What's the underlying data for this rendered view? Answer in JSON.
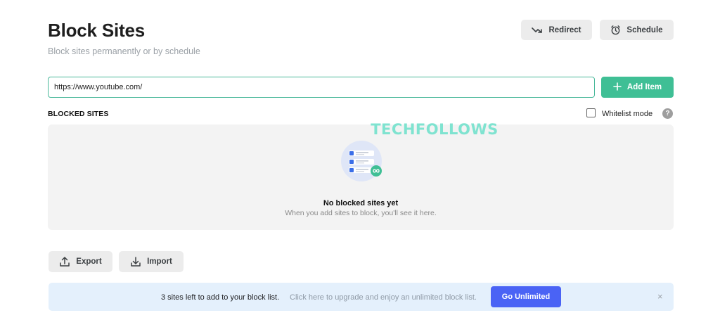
{
  "header": {
    "title": "Block Sites",
    "subtitle": "Block sites permanently or by schedule",
    "redirect_label": "Redirect",
    "schedule_label": "Schedule"
  },
  "add_bar": {
    "input_value": "https://www.youtube.com/",
    "add_label": "Add Item"
  },
  "blocked": {
    "section_label": "BLOCKED SITES",
    "whitelist_label": "Whitelist mode",
    "help_glyph": "?",
    "empty_title": "No blocked sites yet",
    "empty_subtitle": "When you add sites to block, you'll see it here."
  },
  "watermark": "TECHFOLLOWS",
  "footer_actions": {
    "export_label": "Export",
    "import_label": "Import"
  },
  "upgrade": {
    "strong_text": "3 sites left to add to your block list.",
    "light_text": "Click here to upgrade and enjoy an unlimited block list.",
    "button_label": "Go Unlimited",
    "close_glyph": "×"
  },
  "colors": {
    "accent_green": "#3fbf95",
    "accent_blue": "#4a63f5",
    "banner_bg": "#e4f0fc",
    "watermark": "#7fe3d0"
  },
  "icons": {
    "redirect": "redirect-arrow-icon",
    "schedule": "alarm-clock-icon",
    "add": "plus-icon",
    "export": "upload-icon",
    "import": "download-icon",
    "help": "question-mark-icon",
    "close": "close-icon",
    "empty_state": "blocked-list-illustration"
  }
}
